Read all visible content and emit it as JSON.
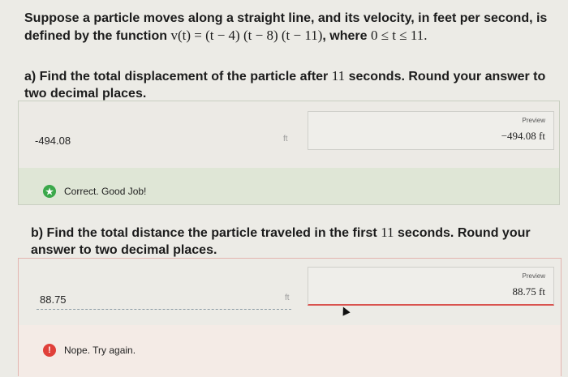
{
  "question": {
    "intro": "Suppose a particle moves along a straight line, and its velocity, in feet per second, is",
    "defined_prefix": "defined by the function",
    "function": "v(t) = (t − 4) (t − 8) (t − 11)",
    "where_text": ", where",
    "domain": "0 ≤ t ≤ 11."
  },
  "part_a": {
    "question_line1_pre": "a) Find the total displacement of the particle after",
    "question_line1_num": "11",
    "question_line1_post": "seconds. Round your answer to",
    "question_line2": "two decimal places.",
    "answer": "-494.08",
    "unit": "ft",
    "preview_label": "Preview",
    "preview_value": "−494.08 ft",
    "feedback": "Correct. Good Job!",
    "feedback_color": "#3aa84a"
  },
  "part_b": {
    "question_line1_pre": "b) Find the total distance the particle traveled in the first",
    "question_line1_num": "11",
    "question_line1_post": "seconds. Round your",
    "question_line2": "answer to two decimal places.",
    "answer": "88.75",
    "unit": "ft",
    "preview_label": "Preview",
    "preview_value": "88.75 ft",
    "feedback": "Nope. Try again.",
    "feedback_color": "#e0403a"
  }
}
